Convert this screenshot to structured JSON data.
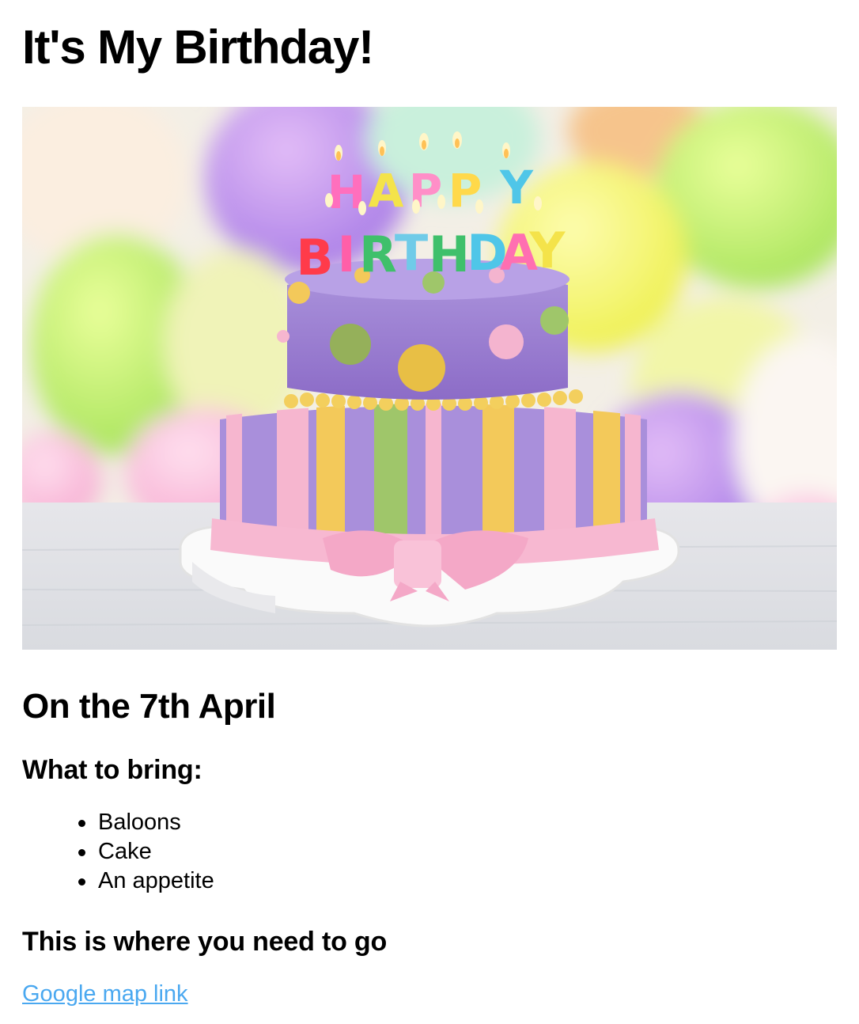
{
  "page": {
    "title": "It's My Birthday!",
    "date_heading": "On the 7th April",
    "bring_heading": "What to bring:",
    "bring_items": [
      "Baloons",
      "Cake",
      "An appetite"
    ],
    "where_heading": "This is where you need to go",
    "map_link_text": "Google map link"
  },
  "hero_image": {
    "candle_letters_top": [
      "H",
      "A",
      "P",
      "P",
      "Y"
    ],
    "candle_letters_bottom": [
      "B",
      "I",
      "R",
      "T",
      "H",
      "D",
      "A",
      "Y"
    ]
  },
  "colors": {
    "link": "#4aa8f0",
    "cake_purple": "#9b7fd0",
    "cake_pink": "#f6b6cf",
    "cake_yellow": "#f3c95a",
    "cake_green": "#9fc66a"
  }
}
